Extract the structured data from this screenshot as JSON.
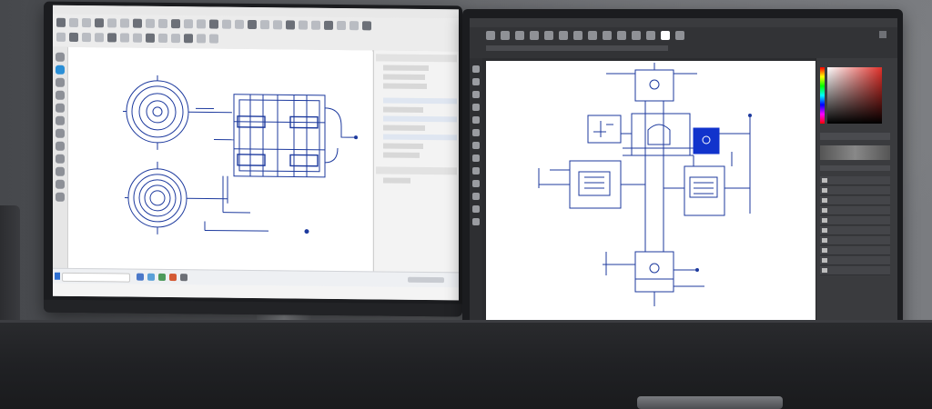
{
  "scene": {
    "colors": {
      "wall": "#5a5c60",
      "desk": "#202124",
      "bezel": "#1b1c1f",
      "schematic_blue": "#1d3a9e",
      "highlight_blue": "#1133cc"
    }
  },
  "left_monitor": {
    "app_title": "",
    "taskbar": {
      "search_placeholder": ""
    },
    "side_panel": {
      "items": []
    },
    "icons": [
      "select-icon",
      "line-icon",
      "circle-icon",
      "arc-icon",
      "layer-icon",
      "zoom-icon",
      "save-icon"
    ]
  },
  "right_monitor": {
    "app_title": "",
    "taskbar": {
      "search_placeholder": ""
    },
    "icons": [
      "move-icon",
      "brush-icon",
      "eraser-icon",
      "text-icon",
      "shape-icon",
      "eyedropper-icon",
      "color-picker-icon"
    ]
  }
}
